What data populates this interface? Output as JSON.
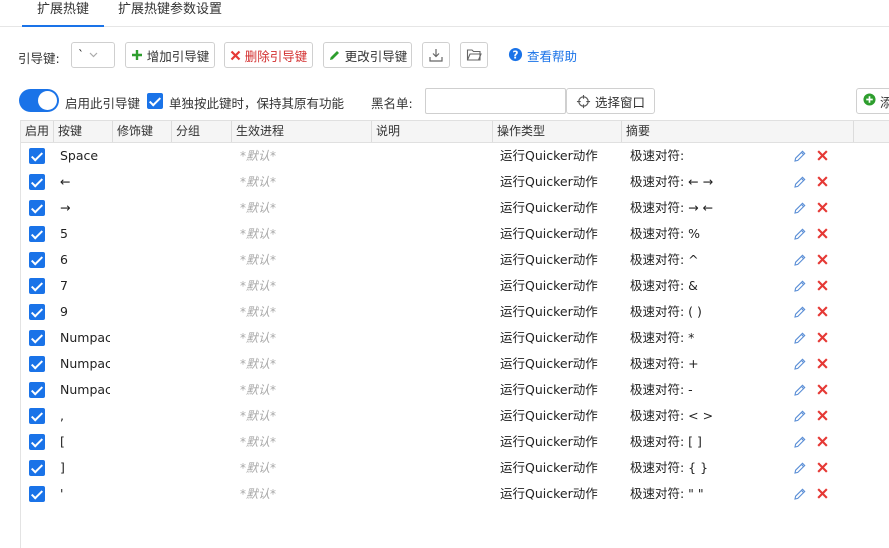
{
  "tabs": [
    {
      "label": "扩展热键",
      "active": true
    },
    {
      "label": "扩展热键参数设置",
      "active": false
    }
  ],
  "toolbar": {
    "leader_label": "引导键:",
    "leader_value": "`",
    "add_label": "增加引导键",
    "delete_label": "删除引导键",
    "edit_label": "更改引导键",
    "help_label": "查看帮助"
  },
  "options": {
    "enable_label": "启用此引导键",
    "single_label": "单独按此键时，保持其原有功能",
    "blacklist_label": "黑名单:",
    "blacklist_value": "",
    "select_window_label": "选择窗口",
    "add_label": "添"
  },
  "columns": [
    "启用",
    "按键",
    "修饰键",
    "分组",
    "生效进程",
    "说明",
    "操作类型",
    "摘要"
  ],
  "rows": [
    {
      "key": "Space",
      "modifier": "",
      "group": "",
      "process": "*默认*",
      "note": "",
      "action": "运行Quicker动作",
      "summary": "极速对符:"
    },
    {
      "key": "←",
      "modifier": "",
      "group": "",
      "process": "*默认*",
      "note": "",
      "action": "运行Quicker动作",
      "summary": "极速对符: ← →"
    },
    {
      "key": "→",
      "modifier": "",
      "group": "",
      "process": "*默认*",
      "note": "",
      "action": "运行Quicker动作",
      "summary": "极速对符: → ←"
    },
    {
      "key": "5",
      "modifier": "",
      "group": "",
      "process": "*默认*",
      "note": "",
      "action": "运行Quicker动作",
      "summary": "极速对符: %"
    },
    {
      "key": "6",
      "modifier": "",
      "group": "",
      "process": "*默认*",
      "note": "",
      "action": "运行Quicker动作",
      "summary": "极速对符: ^"
    },
    {
      "key": "7",
      "modifier": "",
      "group": "",
      "process": "*默认*",
      "note": "",
      "action": "运行Quicker动作",
      "summary": "极速对符: &"
    },
    {
      "key": "9",
      "modifier": "",
      "group": "",
      "process": "*默认*",
      "note": "",
      "action": "运行Quicker动作",
      "summary": "极速对符: ( )"
    },
    {
      "key": "Numpac",
      "modifier": "",
      "group": "",
      "process": "*默认*",
      "note": "",
      "action": "运行Quicker动作",
      "summary": "极速对符: *"
    },
    {
      "key": "Numpac",
      "modifier": "",
      "group": "",
      "process": "*默认*",
      "note": "",
      "action": "运行Quicker动作",
      "summary": "极速对符: +"
    },
    {
      "key": "Numpac",
      "modifier": "",
      "group": "",
      "process": "*默认*",
      "note": "",
      "action": "运行Quicker动作",
      "summary": "极速对符: -"
    },
    {
      "key": ",",
      "modifier": "",
      "group": "",
      "process": "*默认*",
      "note": "",
      "action": "运行Quicker动作",
      "summary": "极速对符: < >"
    },
    {
      "key": "[",
      "modifier": "",
      "group": "",
      "process": "*默认*",
      "note": "",
      "action": "运行Quicker动作",
      "summary": "极速对符: [ ]"
    },
    {
      "key": "]",
      "modifier": "",
      "group": "",
      "process": "*默认*",
      "note": "",
      "action": "运行Quicker动作",
      "summary": "极速对符: { }"
    },
    {
      "key": "'",
      "modifier": "",
      "group": "",
      "process": "*默认*",
      "note": "",
      "action": "运行Quicker动作",
      "summary": "极速对符: \" \""
    }
  ],
  "icons": {
    "add": "plus-icon",
    "delete": "x-icon",
    "edit": "pencil-icon",
    "import": "download-tray-icon",
    "open": "folder-icon",
    "help": "question-circle-icon",
    "select_window": "crosshair-icon",
    "row_edit": "pencil-icon",
    "row_delete": "x-icon"
  },
  "colors": {
    "accent": "#1a73e8",
    "add_green": "#2e9e2e",
    "delete_red": "#e53935",
    "edit_pencil": "#5b8fd6",
    "default_text": "#a8a8a8"
  }
}
